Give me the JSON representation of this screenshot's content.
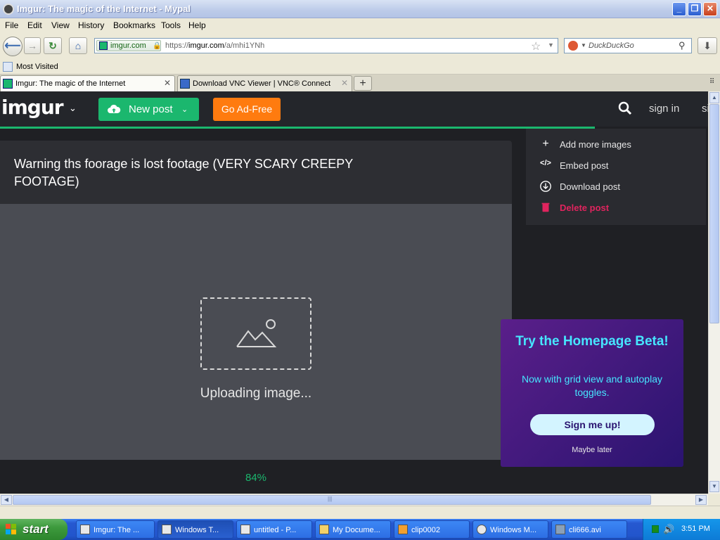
{
  "window": {
    "title": "Imgur: The magic of the Internet - Mypal"
  },
  "menu": {
    "file": "File",
    "edit": "Edit",
    "view": "View",
    "history": "History",
    "bookmarks": "Bookmarks",
    "tools": "Tools",
    "help": "Help"
  },
  "urlbar": {
    "identity": "imgur.com",
    "url_prefix": "https://",
    "url_domain": "imgur.com",
    "url_path": "/a/mhi1YNh"
  },
  "searchbar": {
    "placeholder": "DuckDuckGo"
  },
  "bookmarks": {
    "most_visited": "Most Visited"
  },
  "tabs": [
    {
      "label": "Imgur: The magic of the Internet",
      "close": "✕"
    },
    {
      "label": "Download VNC Viewer | VNC® Connect",
      "close": "✕"
    }
  ],
  "imgur": {
    "logo": "imgur",
    "new_post": "New post",
    "go_ad_free": "Go Ad-Free",
    "sign_in": "sign in",
    "sign_up": "sign up",
    "post_title": "Warning ths foorage is lost footage (VERY SCARY CREEPY FOOTAGE)",
    "uploading": "Uploading image...",
    "progress": "84%",
    "upload_progress": 0.84,
    "menu": [
      {
        "label": "Add more images",
        "icon": "plus-icon"
      },
      {
        "label": "Embed post",
        "icon": "code-icon"
      },
      {
        "label": "Download post",
        "icon": "download-icon"
      },
      {
        "label": "Delete post",
        "icon": "trash-icon"
      }
    ],
    "beta": {
      "title": "Try the Homepage Beta!",
      "subtitle": "Now with grid view and autoplay toggles.",
      "button": "Sign me up!",
      "later": "Maybe later"
    }
  },
  "taskbar": {
    "start": "start",
    "items": [
      {
        "label": "Imgur: The ..."
      },
      {
        "label": "Windows T..."
      },
      {
        "label": "untitled - P..."
      },
      {
        "label": "My Docume..."
      },
      {
        "label": "clip0002"
      },
      {
        "label": "Windows M..."
      },
      {
        "label": "cli666.avi"
      }
    ],
    "clock": "3:51 PM"
  },
  "colors": {
    "imgur_green": "#1bb76e",
    "ad_free_orange": "#ff7b0f",
    "delete_red": "#e0245e",
    "beta_cyan": "#46e6ff"
  }
}
